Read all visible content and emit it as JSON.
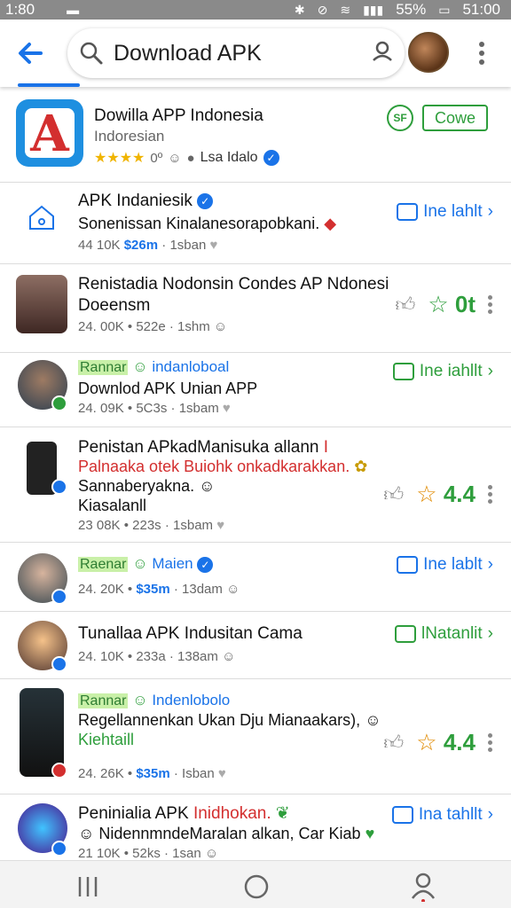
{
  "status_bar": {
    "time": "1:80",
    "battery": "55%",
    "clock_right": "51:00"
  },
  "search": {
    "query": "Download APK"
  },
  "featured": {
    "title": "Dowilla APP Indonesia",
    "subtitle": "Indoresian",
    "stars": "★★★★",
    "rating_text": "0º",
    "publisher": "Lsa Idalo",
    "open_label": "Cowe",
    "badge_text": "SF"
  },
  "rows": [
    {
      "title": "APK Indaniesik",
      "line2": "Sonenissan Kinalanesorapobkani.",
      "meta_a": "44 10K",
      "meta_b": "$26m",
      "meta_c": "1sban",
      "action": "Ine lahlt"
    },
    {
      "title": "Renistadia Nodonsin Condes AP Ndonesi",
      "line2": "Doeensm",
      "meta_a": "24. 00K",
      "meta_b": "522e",
      "meta_c": "1shm",
      "score": "0t"
    },
    {
      "tag": "Rannar",
      "channel": "indanloboal",
      "line2": "Downlod APK Unian APP",
      "meta_a": "24. 09K",
      "meta_b": "5C3s",
      "meta_c": "1sbam",
      "action": "Ine iahllt"
    },
    {
      "title": "Penistan APkadManisuka allann",
      "title_mark": "I",
      "line2": "Palnaaka otek Buiohk onkadkarakkan.",
      "line3": "Sannaberyakna.",
      "line4": "Kiasalanll",
      "meta_a": "23 08K",
      "meta_b": "223s",
      "meta_c": "1sbam",
      "score": "4.4"
    },
    {
      "tag": "Raenar",
      "channel": "Maien",
      "meta_a": "24. 20K",
      "meta_b": "$35m",
      "meta_c": "13dam",
      "action": "Ine lablt"
    },
    {
      "title": "Tunallaa APK  Indusitan Cama",
      "meta_a": "24. 10K",
      "meta_b": "233a",
      "meta_c": "138am",
      "action": "lNatanlit"
    },
    {
      "tag": "Rannar",
      "channel": "Indenlobolo",
      "line2": "Regellannenkan Ukan Dju Mianaakars),",
      "line3": "Kiehtaill",
      "meta_a": "24. 26K",
      "meta_b": "$35m",
      "meta_c": "Isban",
      "score": "4.4"
    },
    {
      "title": "Peninialia APK",
      "title_red": "Inidhokan.",
      "line2": "NidennmndeMaralan alkan, Car Kiab",
      "meta_a": "21 10K",
      "meta_b": "52ks",
      "meta_c": "1san",
      "action": "Ina tahllt"
    }
  ],
  "colors": {
    "accent": "#1a73e8",
    "green": "#2e9e3c",
    "red": "#d32f2f",
    "star": "#f0b400"
  }
}
